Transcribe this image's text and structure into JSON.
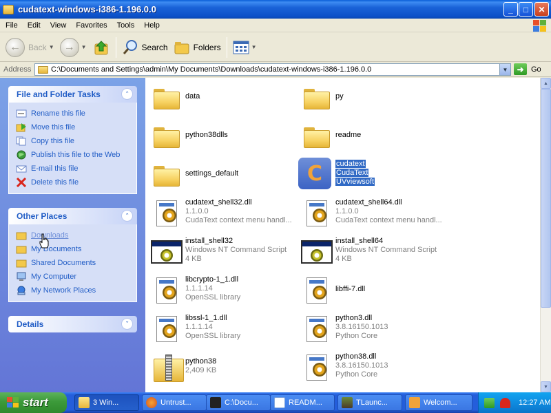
{
  "window": {
    "title": "cudatext-windows-i386-1.196.0.0",
    "buttons": {
      "minimize": "_",
      "maximize": "□",
      "close": "✕"
    }
  },
  "menu": [
    "File",
    "Edit",
    "View",
    "Favorites",
    "Tools",
    "Help"
  ],
  "toolbar": {
    "back": "Back",
    "forward_icon": "arrow-right-icon",
    "search": "Search",
    "folders": "Folders"
  },
  "address": {
    "label": "Address",
    "path": "C:\\Documents and Settings\\admin\\My Documents\\Downloads\\cudatext-windows-i386-1.196.0.0",
    "go": "Go"
  },
  "tasks": {
    "file_folder": {
      "title": "File and Folder Tasks",
      "items": [
        "Rename this file",
        "Move this file",
        "Copy this file",
        "Publish this file to the Web",
        "E-mail this file",
        "Delete this file"
      ]
    },
    "other_places": {
      "title": "Other Places",
      "items": [
        "Downloads",
        "My Documents",
        "Shared Documents",
        "My Computer",
        "My Network Places"
      ]
    },
    "details": {
      "title": "Details"
    }
  },
  "files": [
    {
      "name": "data",
      "type": "folder"
    },
    {
      "name": "py",
      "type": "folder"
    },
    {
      "name": "python38dlls",
      "type": "folder"
    },
    {
      "name": "readme",
      "type": "folder"
    },
    {
      "name": "settings_default",
      "type": "folder"
    },
    {
      "name": "cudatext",
      "line2": "CudaText",
      "line3": "UVviewsoft",
      "type": "app",
      "selected": true
    },
    {
      "name": "cudatext_shell32.dll",
      "line2": "1.1.0.0",
      "line3": "CudaText context menu handl...",
      "type": "dll"
    },
    {
      "name": "cudatext_shell64.dll",
      "line2": "1.1.0.0",
      "line3": "CudaText context menu handl...",
      "type": "dll"
    },
    {
      "name": "install_shell32",
      "line2": "Windows NT Command Script",
      "line3": "4 KB",
      "type": "cmd"
    },
    {
      "name": "install_shell64",
      "line2": "Windows NT Command Script",
      "line3": "4 KB",
      "type": "cmd"
    },
    {
      "name": "libcrypto-1_1.dll",
      "line2": "1.1.1.14",
      "line3": "OpenSSL library",
      "type": "dll"
    },
    {
      "name": "libffi-7.dll",
      "type": "dll"
    },
    {
      "name": "libssl-1_1.dll",
      "line2": "1.1.1.14",
      "line3": "OpenSSL library",
      "type": "dll"
    },
    {
      "name": "python3.dll",
      "line2": "3.8.16150.1013",
      "line3": "Python Core",
      "type": "dll"
    },
    {
      "name": "python38",
      "line2": "2,409 KB",
      "type": "zip"
    },
    {
      "name": "python38.dll",
      "line2": "3.8.16150.1013",
      "line3": "Python Core",
      "type": "dll"
    }
  ],
  "taskbar": {
    "start": "start",
    "buttons": [
      "3 Win...",
      "Untrust...",
      "C:\\Docu...",
      "READM...",
      "TLaunc...",
      "Welcom..."
    ],
    "clock": "12:27 AM"
  },
  "colors": {
    "title_blue": "#0B50C8",
    "task_link": "#215DC6",
    "selection": "#316AC5",
    "start_green": "#3C9A3A"
  }
}
